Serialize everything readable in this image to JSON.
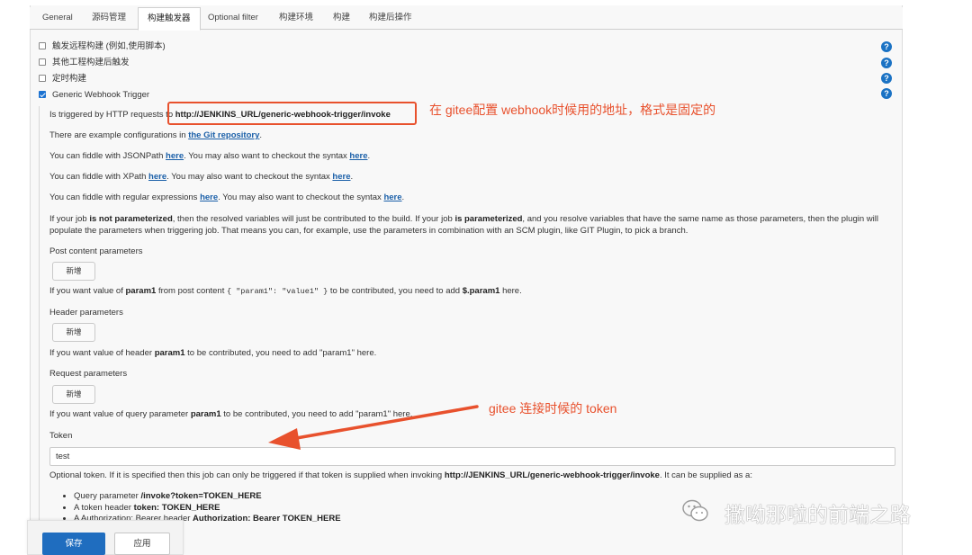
{
  "tabs": [
    {
      "label": "General"
    },
    {
      "label": "源码管理"
    },
    {
      "label": "构建触发器"
    },
    {
      "label": "Optional filter"
    },
    {
      "label": "构建环境"
    },
    {
      "label": "构建"
    },
    {
      "label": "构建后操作"
    }
  ],
  "active_tab": "构建触发器",
  "triggers": [
    {
      "label": "触发远程构建 (例如,使用脚本)",
      "checked": false
    },
    {
      "label": "其他工程构建后触发",
      "checked": false
    },
    {
      "label": "定时构建",
      "checked": false
    },
    {
      "label": "Generic Webhook Trigger",
      "checked": true
    }
  ],
  "help_icon_glyph": "?",
  "webhook": {
    "triggered_prefix": "Is triggered by HTTP requests to",
    "url": "http://JENKINS_URL/generic-webhook-trigger/invoke",
    "example_prefix": "There are example configurations in",
    "example_link": "the Git repository",
    "jsonpath_prefix": "You can fiddle with JSONPath",
    "xpath_prefix": "You can fiddle with XPath",
    "regex_prefix": "You can fiddle with regular expressions",
    "here": "here",
    "checkout_mid": ". You may also want to checkout the syntax",
    "dot": ".",
    "param_a": "If your job",
    "param_b": "is not parameterized",
    "param_c": ", then the resolved variables will just be contributed to the build. If your job",
    "param_d": "is parameterized",
    "param_e": ", and you resolve variables that have the same name as those parameters, then the plugin will populate the parameters when triggering job. That means you can, for example, use the parameters in combination with an SCM plugin, like GIT Plugin, to pick a branch."
  },
  "post_content": {
    "label": "Post content parameters",
    "button": "新增",
    "hint_a": "If you want value of",
    "param": "param1",
    "hint_b": "from post content",
    "code": "{ \"param1\": \"value1\" }",
    "hint_c": "to be contributed, you need to add",
    "path": "$.param1",
    "hint_d": "here."
  },
  "header_params": {
    "label": "Header parameters",
    "button": "新增",
    "hint_a": "If you want value of header",
    "param": "param1",
    "hint_b": "to be contributed, you need to add \"param1\" here."
  },
  "request_params": {
    "label": "Request parameters",
    "button": "新增",
    "hint_a": "If you want value of query parameter",
    "param": "param1",
    "hint_b": "to be contributed, you need to add \"param1\" here."
  },
  "token": {
    "label": "Token",
    "value": "test",
    "desc_a": "Optional token. If it is specified then this job can only be triggered if that token is supplied when invoking",
    "desc_url": "http://JENKINS_URL/generic-webhook-trigger/invoke",
    "desc_b": ". It can be supplied as a:",
    "options": [
      {
        "text": "Query parameter",
        "bold": "/invoke?token=TOKEN_HERE"
      },
      {
        "text": "A token header",
        "bold": "token: TOKEN_HERE"
      },
      {
        "text": "A Authorization: Bearer header",
        "bold": "Authorization: Bearer TOKEN_HERE"
      }
    ]
  },
  "buttons": {
    "save": "保存",
    "apply": "应用"
  },
  "annotations": {
    "url_note": "在 gitee配置 webhook时候用的地址，格式是固定的",
    "token_note": "gitee 连接时候的 token"
  },
  "watermark": "撒呦那啦的前端之路",
  "colors": {
    "annotation": "#e8512d",
    "link": "#1a5fa8",
    "primary_button": "#1f6dbf",
    "help_icon": "#1a72c4"
  }
}
